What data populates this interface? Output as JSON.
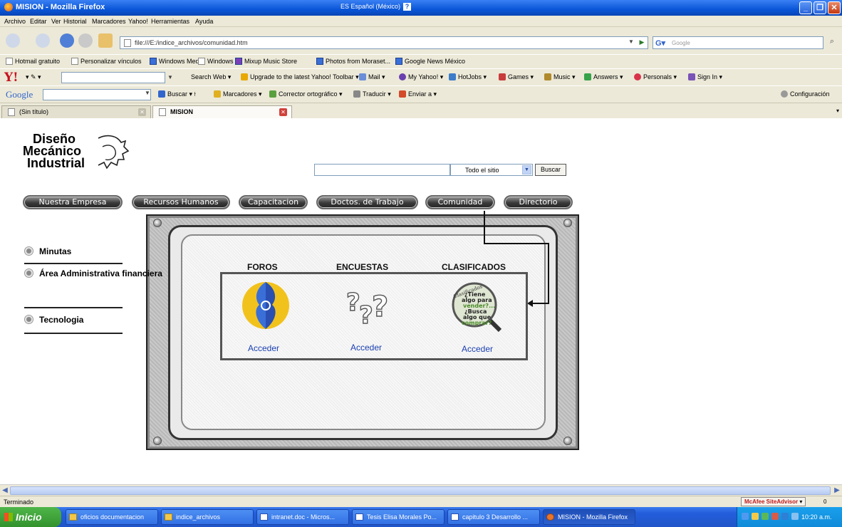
{
  "window": {
    "title": "MISION - Mozilla Firefox",
    "language": "ES Español (México)",
    "help_glyph": "?"
  },
  "menu": [
    "Archivo",
    "Editar",
    "Ver",
    "Historial",
    "Marcadores",
    "Yahoo!",
    "Herramientas",
    "Ayuda"
  ],
  "address": {
    "url": "file:///E:/indice_archivos/comunidad.htm",
    "search_placeholder": "Google"
  },
  "bookmarks": [
    "Hotmail gratuito",
    "Personalizar vínculos",
    "Windows Media",
    "Windows",
    "Mixup Music Store",
    "Photos from Moraset...",
    "Google News México"
  ],
  "yahoo_toolbar": {
    "logo": "Y!",
    "items": [
      "Search Web",
      "Upgrade to the latest Yahoo! Toolbar",
      "Mail",
      "My Yahoo!",
      "HotJobs",
      "Games",
      "Music",
      "Answers",
      "Personals",
      "Sign In"
    ]
  },
  "google_toolbar": {
    "logo": "Google",
    "items": [
      "Buscar",
      "Marcadores",
      "Corrector ortográfico",
      "Traducir",
      "Enviar a"
    ],
    "settings": "Configuración"
  },
  "tabs": [
    {
      "label": "(Sin título)"
    },
    {
      "label": "MISION"
    }
  ],
  "page": {
    "logo": {
      "line1": "Diseño",
      "line2": "Mecánico",
      "line3": "Industrial"
    },
    "search": {
      "value": "",
      "scope": "Todo el sitio",
      "button": "Buscar"
    },
    "nav": [
      "Nuestra Empresa",
      "Recursos Humanos",
      "Capacitacion",
      "Doctos. de Trabajo",
      "Comunidad",
      "Directorio"
    ],
    "sidebar": [
      "Minutas",
      "Área Administrativa financiera",
      "Tecnologia"
    ],
    "sections": [
      {
        "heading": "FOROS",
        "link": "Acceder",
        "icon": "forum-faces-icon"
      },
      {
        "heading": "ENCUESTAS",
        "link": "Acceder",
        "icon": "question-marks-icon"
      },
      {
        "heading": "CLASIFICADOS",
        "link": "Acceder",
        "icon": "classifieds-magnifier-icon",
        "icon_text": [
          "Clasificados",
          "¿Tiene",
          "algo para",
          "vender?...",
          "¿Busca",
          "algo que",
          "comprar?"
        ]
      }
    ]
  },
  "status": {
    "text": "Terminado",
    "addon": "McAfee SiteAdvisor",
    "count": "0"
  },
  "taskbar": {
    "start": "Inicio",
    "tasks": [
      "oficios documentacion",
      "indice_archivos",
      "intranet.doc - Micros...",
      "Tesis Elisa Morales Po...",
      "capitulo 3 Desarrollo ...",
      "MISION - Mozilla Firefox"
    ],
    "clock": "10:20 a.m."
  },
  "colors": {
    "title_blue": "#0a56d8",
    "taskbar_blue": "#245edb",
    "link_blue": "#1a3fb0",
    "start_green": "#32922d"
  }
}
